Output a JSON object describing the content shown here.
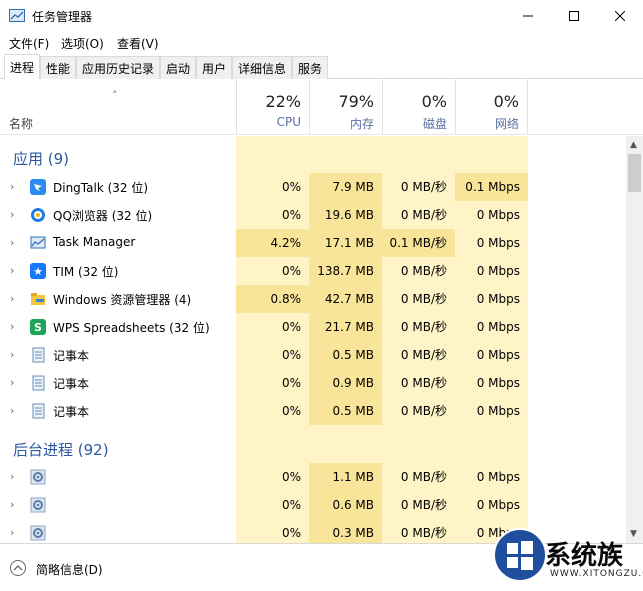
{
  "window": {
    "title": "任务管理器"
  },
  "menu": [
    "文件(F)",
    "选项(O)",
    "查看(V)"
  ],
  "tabs": [
    "进程",
    "性能",
    "应用历史记录",
    "启动",
    "用户",
    "详细信息",
    "服务"
  ],
  "header": {
    "name_label": "名称",
    "cpu": {
      "pct": "22%",
      "label": "CPU"
    },
    "mem": {
      "pct": "79%",
      "label": "内存"
    },
    "disk": {
      "pct": "0%",
      "label": "磁盘"
    },
    "net": {
      "pct": "0%",
      "label": "网络"
    }
  },
  "groups": {
    "apps": "应用 (9)",
    "background": "后台进程 (92)"
  },
  "apps": [
    {
      "name": "DingTalk (32 位)",
      "icon": "dingtalk-icon",
      "cpu": "0%",
      "mem": "7.9 MB",
      "disk": "0 MB/秒",
      "net": "0.1 Mbps"
    },
    {
      "name": "QQ浏览器 (32 位)",
      "icon": "qq-browser-icon",
      "cpu": "0%",
      "mem": "19.6 MB",
      "disk": "0 MB/秒",
      "net": "0 Mbps"
    },
    {
      "name": "Task Manager",
      "icon": "task-manager-icon",
      "cpu": "4.2%",
      "mem": "17.1 MB",
      "disk": "0.1 MB/秒",
      "net": "0 Mbps"
    },
    {
      "name": "TIM (32 位)",
      "icon": "tim-icon",
      "cpu": "0%",
      "mem": "138.7 MB",
      "disk": "0 MB/秒",
      "net": "0 Mbps"
    },
    {
      "name": "Windows 资源管理器 (4)",
      "icon": "explorer-icon",
      "cpu": "0.8%",
      "mem": "42.7 MB",
      "disk": "0 MB/秒",
      "net": "0 Mbps"
    },
    {
      "name": "WPS Spreadsheets (32 位)",
      "icon": "wps-icon",
      "cpu": "0%",
      "mem": "21.7 MB",
      "disk": "0 MB/秒",
      "net": "0 Mbps"
    },
    {
      "name": "记事本",
      "icon": "notepad-icon",
      "cpu": "0%",
      "mem": "0.5 MB",
      "disk": "0 MB/秒",
      "net": "0 Mbps"
    },
    {
      "name": "记事本",
      "icon": "notepad-icon",
      "cpu": "0%",
      "mem": "0.9 MB",
      "disk": "0 MB/秒",
      "net": "0 Mbps"
    },
    {
      "name": "记事本",
      "icon": "notepad-icon",
      "cpu": "0%",
      "mem": "0.5 MB",
      "disk": "0 MB/秒",
      "net": "0 Mbps"
    }
  ],
  "background": [
    {
      "name": "",
      "icon": "gear-icon",
      "cpu": "0%",
      "mem": "1.1 MB",
      "disk": "0 MB/秒",
      "net": "0 Mbps"
    },
    {
      "name": "",
      "icon": "gear-icon",
      "cpu": "0%",
      "mem": "0.6 MB",
      "disk": "0 MB/秒",
      "net": "0 Mbps"
    },
    {
      "name": "",
      "icon": "gear-icon",
      "cpu": "0%",
      "mem": "0.3 MB",
      "disk": "0 MB/秒",
      "net": "0 Mbps"
    }
  ],
  "footer": {
    "label": "简略信息(D)"
  },
  "watermark": {
    "brand": "系统族",
    "url": "WWW.XITONGZU.COM"
  }
}
